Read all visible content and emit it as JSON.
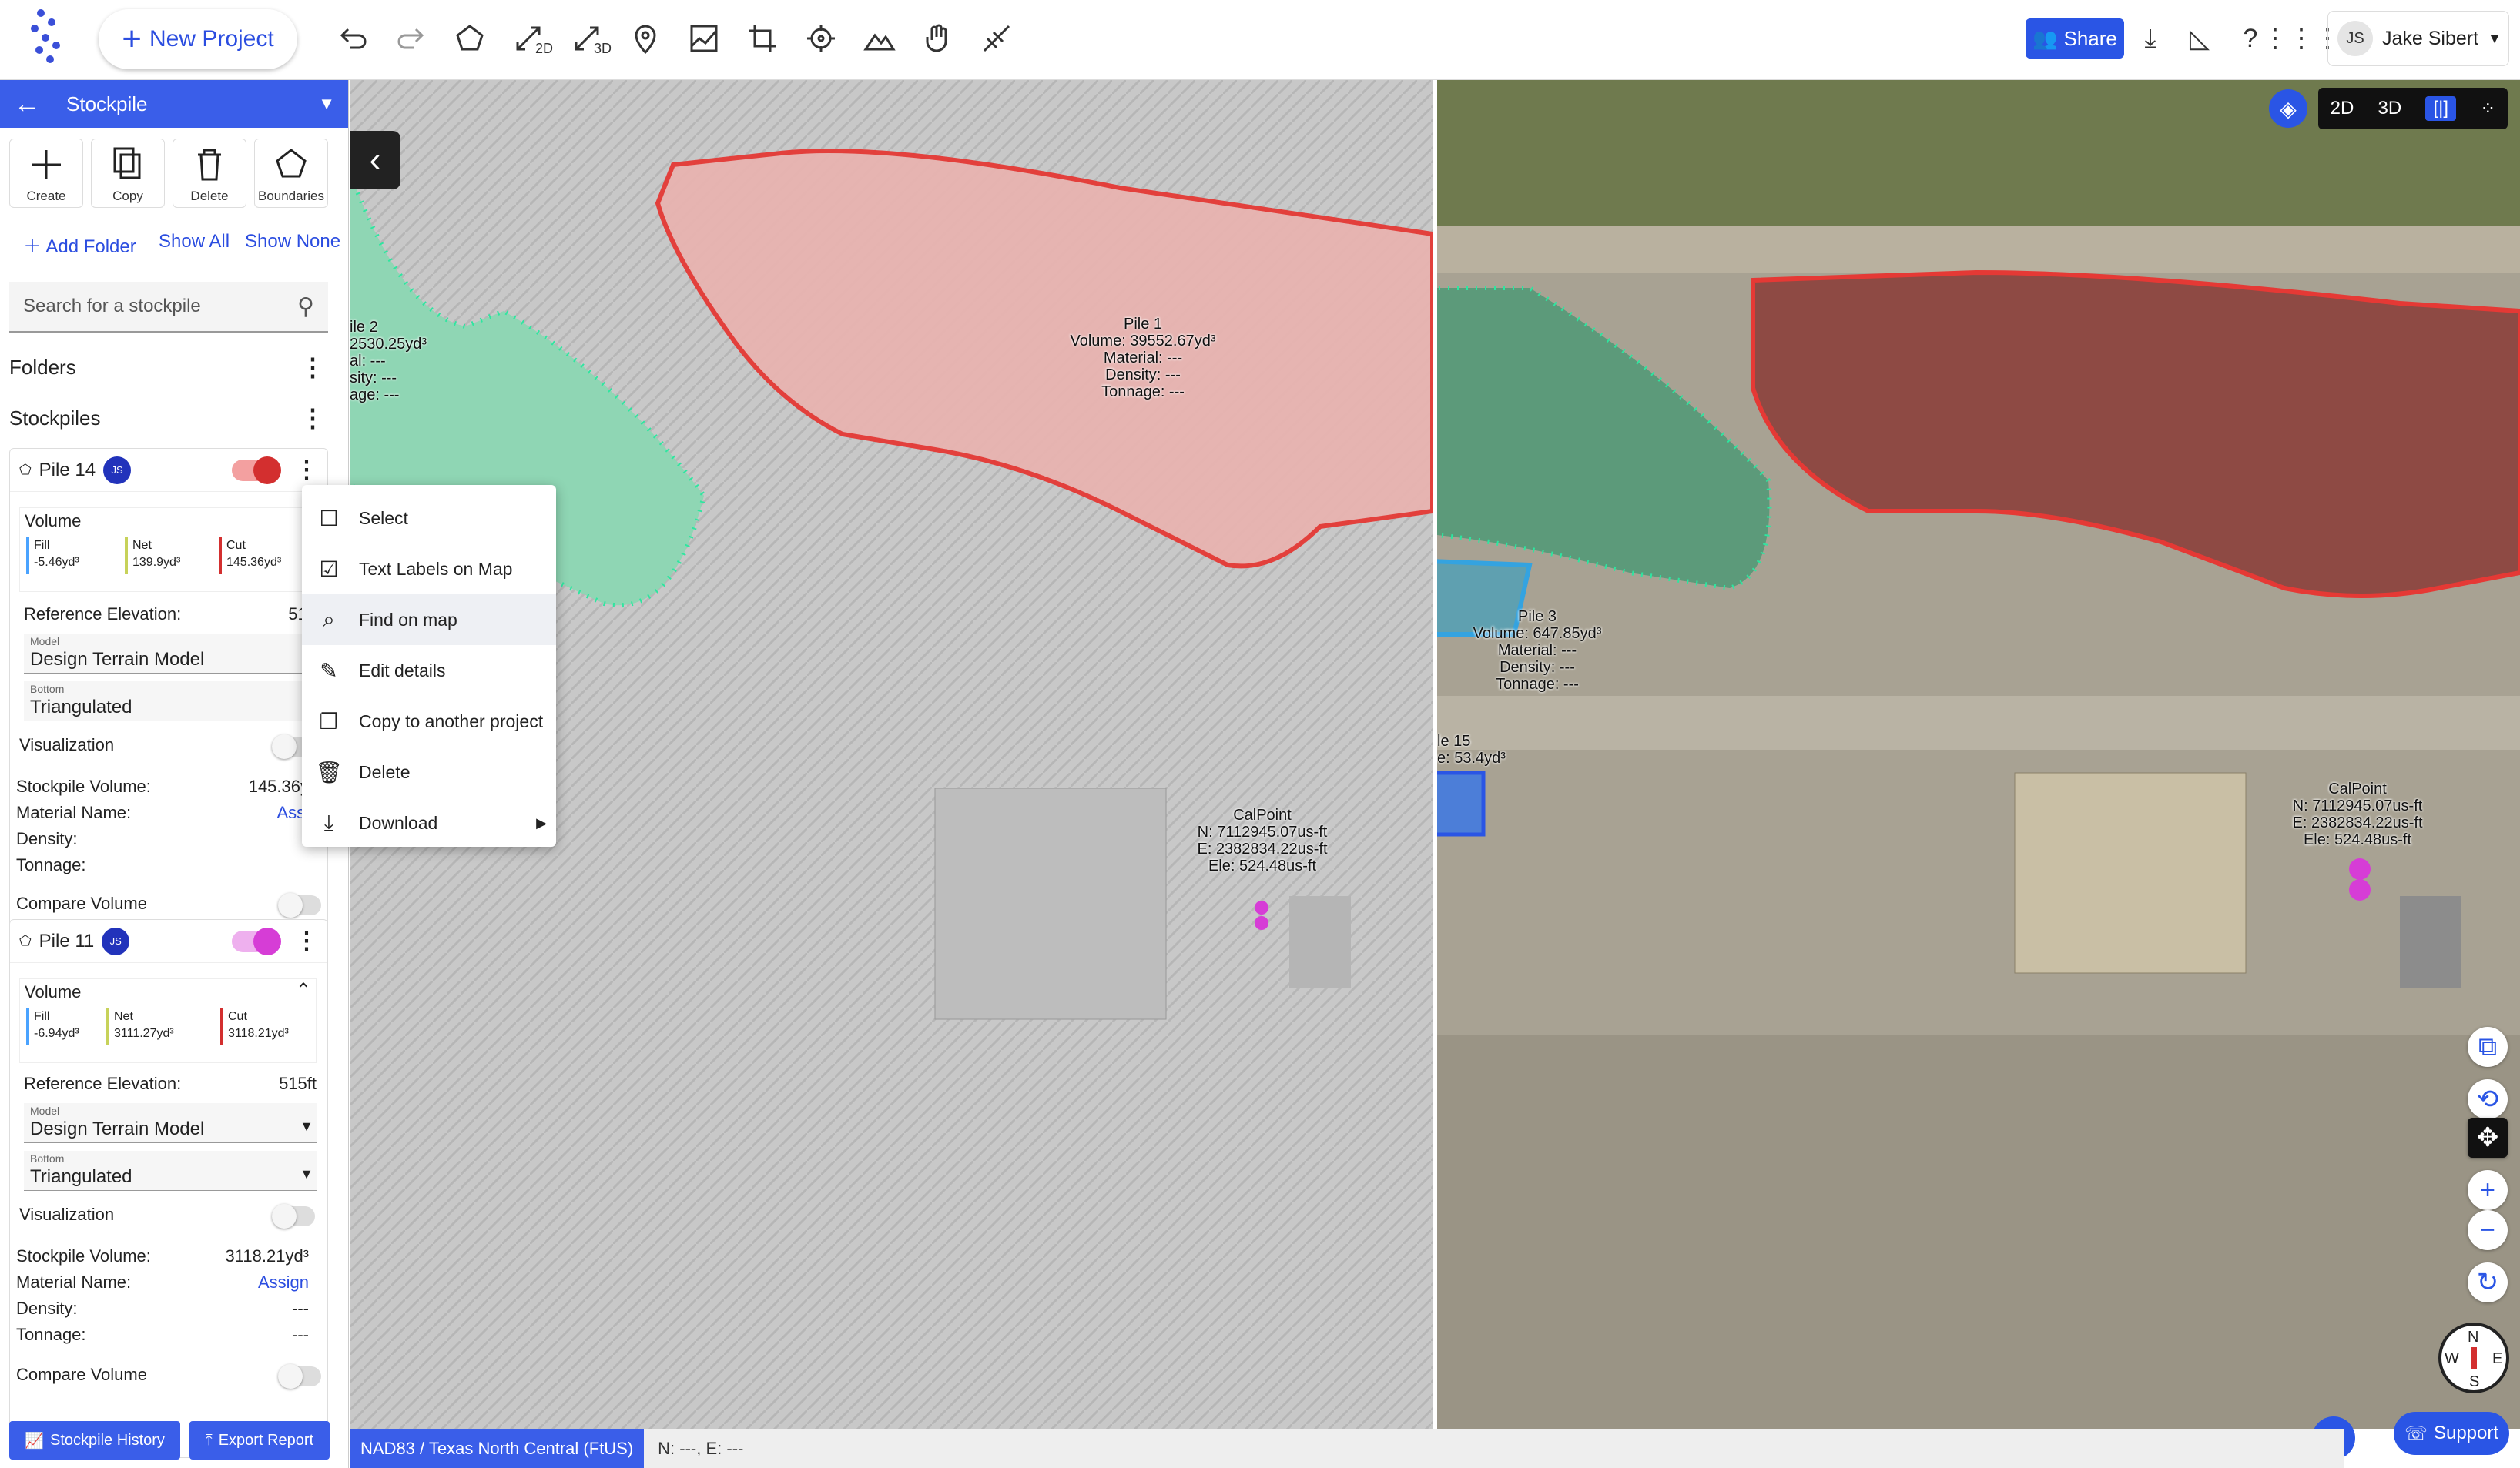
{
  "toolbar": {
    "new_project": "New Project",
    "tools": [
      "undo-icon",
      "redo-icon",
      "polygon-icon",
      "measure-2d-icon",
      "measure-3d-icon",
      "pin-icon",
      "profile-icon",
      "crop-icon",
      "target-icon",
      "terrain-icon",
      "hand-icon",
      "tilt-icon"
    ],
    "tool_sub_2d": "2D",
    "tool_sub_3d": "3D",
    "share": "Share",
    "user_initials": "JS",
    "user_name": "Jake Sibert"
  },
  "sidebar": {
    "title": "Stockpile",
    "actions": {
      "create": "Create",
      "copy": "Copy",
      "delete": "Delete",
      "boundaries": "Boundaries"
    },
    "links": {
      "add_folder": "Add Folder",
      "show_all": "Show All",
      "show_none": "Show None"
    },
    "search_placeholder": "Search for a stockpile",
    "folders": "Folders",
    "stockpiles": "Stockpiles",
    "pile14": {
      "name": "Pile 14",
      "badge": "JS",
      "toggle_color": "#d32f2f",
      "volume": "Volume",
      "fill_label": "Fill",
      "fill": "-5.46yd³",
      "net_label": "Net",
      "net": "139.9yd³",
      "cut_label": "Cut",
      "cut": "145.36yd³",
      "ref_label": "Reference Elevation:",
      "ref_value": "512",
      "model_label": "Model",
      "model": "Design Terrain Model",
      "bottom_label": "Bottom",
      "bottom": "Triangulated",
      "visualization": "Visualization",
      "sv_label": "Stockpile Volume:",
      "sv": "145.36y",
      "mat_label": "Material Name:",
      "mat": "Assi",
      "den_label": "Density:",
      "ton_label": "Tonnage:",
      "compare": "Compare Volume"
    },
    "pile11": {
      "name": "Pile 11",
      "badge": "JS",
      "toggle_color": "#d63dd6",
      "volume": "Volume",
      "fill_label": "Fill",
      "fill": "-6.94yd³",
      "net_label": "Net",
      "net": "3111.27yd³",
      "cut_label": "Cut",
      "cut": "3118.21yd³",
      "ref_label": "Reference Elevation:",
      "ref_value": "515ft",
      "model_label": "Model",
      "model": "Design Terrain Model",
      "bottom_label": "Bottom",
      "bottom": "Triangulated",
      "visualization": "Visualization",
      "sv_label": "Stockpile Volume:",
      "sv": "3118.21yd³",
      "mat_label": "Material Name:",
      "mat": "Assign",
      "den_label": "Density:",
      "den": "---",
      "ton_label": "Tonnage:",
      "ton": "---",
      "compare": "Compare Volume"
    },
    "history": "Stockpile History",
    "export": "Export Report"
  },
  "context_menu": {
    "select": "Select",
    "text_labels": "Text Labels on Map",
    "find": "Find on map",
    "edit": "Edit details",
    "copy": "Copy to another project",
    "delete": "Delete",
    "download": "Download"
  },
  "map_labels": {
    "pile1": [
      "Pile 1",
      "Volume: 39552.67yd³",
      "Material: ---",
      "Density: ---",
      "Tonnage: ---"
    ],
    "pile2_left": [
      "ile 2",
      "2530.25yd³",
      "al: ---",
      "sity: ---",
      "age: ---"
    ],
    "calpoint": [
      "CalPoint",
      "N: 7112945.07us-ft",
      "E: 2382834.22us-ft",
      "Ele: 524.48us-ft"
    ],
    "pile3": [
      "Pile 3",
      "Volume: 647.85yd³",
      "Material: ---",
      "Density: ---",
      "Tonnage: ---"
    ],
    "pile15_right": [
      "le 15",
      "e: 53.4yd³"
    ]
  },
  "view": {
    "mode_2d": "2D",
    "mode_3d": "3D"
  },
  "status": {
    "crs": "NAD83 / Texas North Central (FtUS)",
    "coords": "N: ---, E: ---"
  },
  "support": "Support",
  "compass": {
    "n": "N",
    "s": "S",
    "w": "W",
    "e": "E"
  },
  "colors": {
    "accent": "#3a5ee9",
    "pile_red": "#e53935",
    "pile_green": "#2ee6a0",
    "pile_blue": "#34a3e0",
    "calpoint": "#d63dd6"
  }
}
